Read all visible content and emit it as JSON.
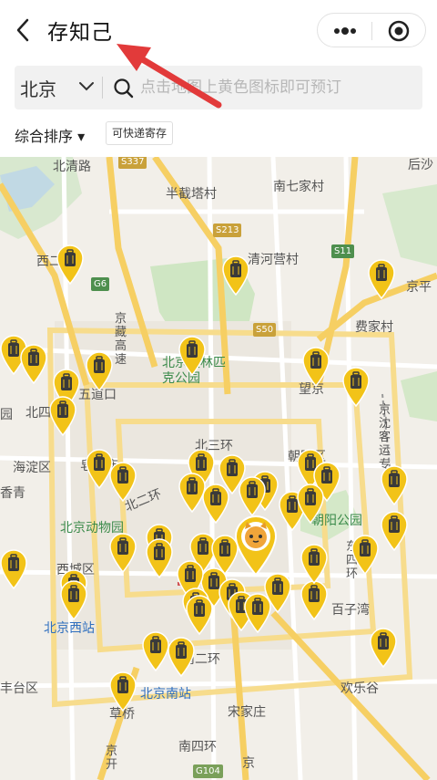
{
  "navbar": {
    "title": "存知己"
  },
  "search": {
    "city": "北京",
    "placeholder": "点击地图上黄色图标即可预订"
  },
  "filters": {
    "sort_label": "综合排序 ▾",
    "tag_label": "可快递寄存"
  },
  "map": {
    "labels": {
      "beiqing_rd": "北清路",
      "houshayu": "后沙",
      "banjieta": "半截塔村",
      "nanqijia": "南七家村",
      "qinghe": "清河营村",
      "xi": "西二",
      "jingping": "京平",
      "jingzang": "京藏高速",
      "feijia": "费家村",
      "olympic": "北京奥林匹克公园",
      "wudaokou": "五道口",
      "wangjing": "望京",
      "jingshen": "京沈客运专",
      "beisi": "北四",
      "yuan": "园",
      "haidian": "海淀区",
      "beisanhuan": "北三环",
      "chaoyang_dist": "朝阳区",
      "zaojunmiao": "皂君庙",
      "erhuan": "北二环",
      "qing": "香青",
      "chaoyang_park": "朝阳公园",
      "zoo": "北京动物园",
      "dongsi": "东四环",
      "xicheng": "西城区",
      "baiziwan": "百子湾",
      "bj_west": "北京西站",
      "nan2": "南二环",
      "bj_south": "北京南站",
      "fengtai": "丰台区",
      "happy_valley": "欢乐谷",
      "caoqiao": "草桥",
      "songjiazhuang": "宋家庄",
      "jingkai": "京开",
      "nan4": "南四环",
      "jing_ex": "京"
    },
    "shields": {
      "s337": "S337",
      "s213": "S213",
      "s11": "S11",
      "g6": "G6",
      "s50": "S50",
      "g104": "G104"
    },
    "storage_pin_count": 48
  },
  "colors": {
    "pin_yellow": "#f2c318",
    "pin_dark": "#3a3a3a",
    "highway": "#f6cf63",
    "ring_road": "#f7dc8c",
    "arrow_red": "#e23a3a"
  }
}
